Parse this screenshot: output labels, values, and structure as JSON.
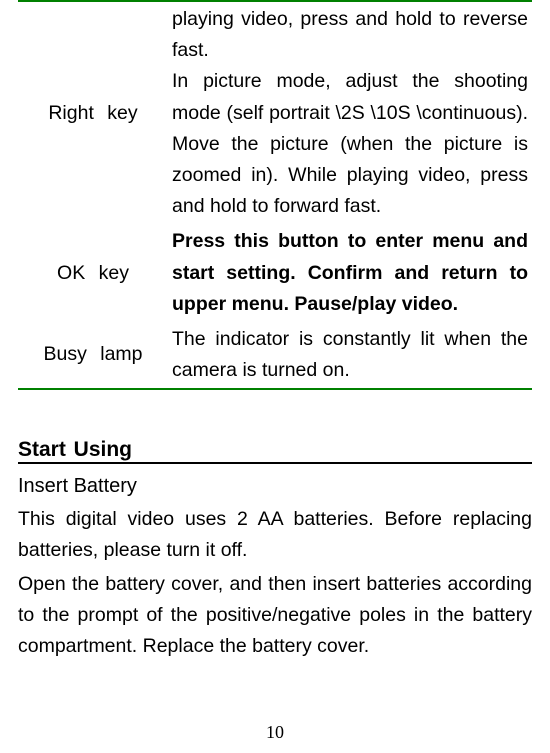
{
  "table": {
    "prev_fragment": "playing video, press and hold to reverse fast.",
    "rows": [
      {
        "label": "Right  key",
        "desc": "In picture mode, adjust the shooting mode (self portrait \\2S \\10S \\continuous). Move the picture (when the picture is zoomed in). While playing video, press and hold to forward fast."
      },
      {
        "label": "OK key",
        "desc": "Press this button to enter menu and start setting. Confirm and return to upper menu. Pause/play video.",
        "bold": true
      },
      {
        "label": "Busy lamp",
        "desc": "The indicator is constantly lit when the camera is turned on."
      }
    ]
  },
  "section": {
    "heading": "Start Using",
    "subheading": "Insert Battery",
    "paragraphs": [
      "This digital video uses 2 AA batteries. Before replacing batteries, please turn it off.",
      "Open the battery cover, and then insert batteries according to the prompt of the positive/negative poles in the battery compartment. Replace the battery cover."
    ]
  },
  "page_number": "10"
}
